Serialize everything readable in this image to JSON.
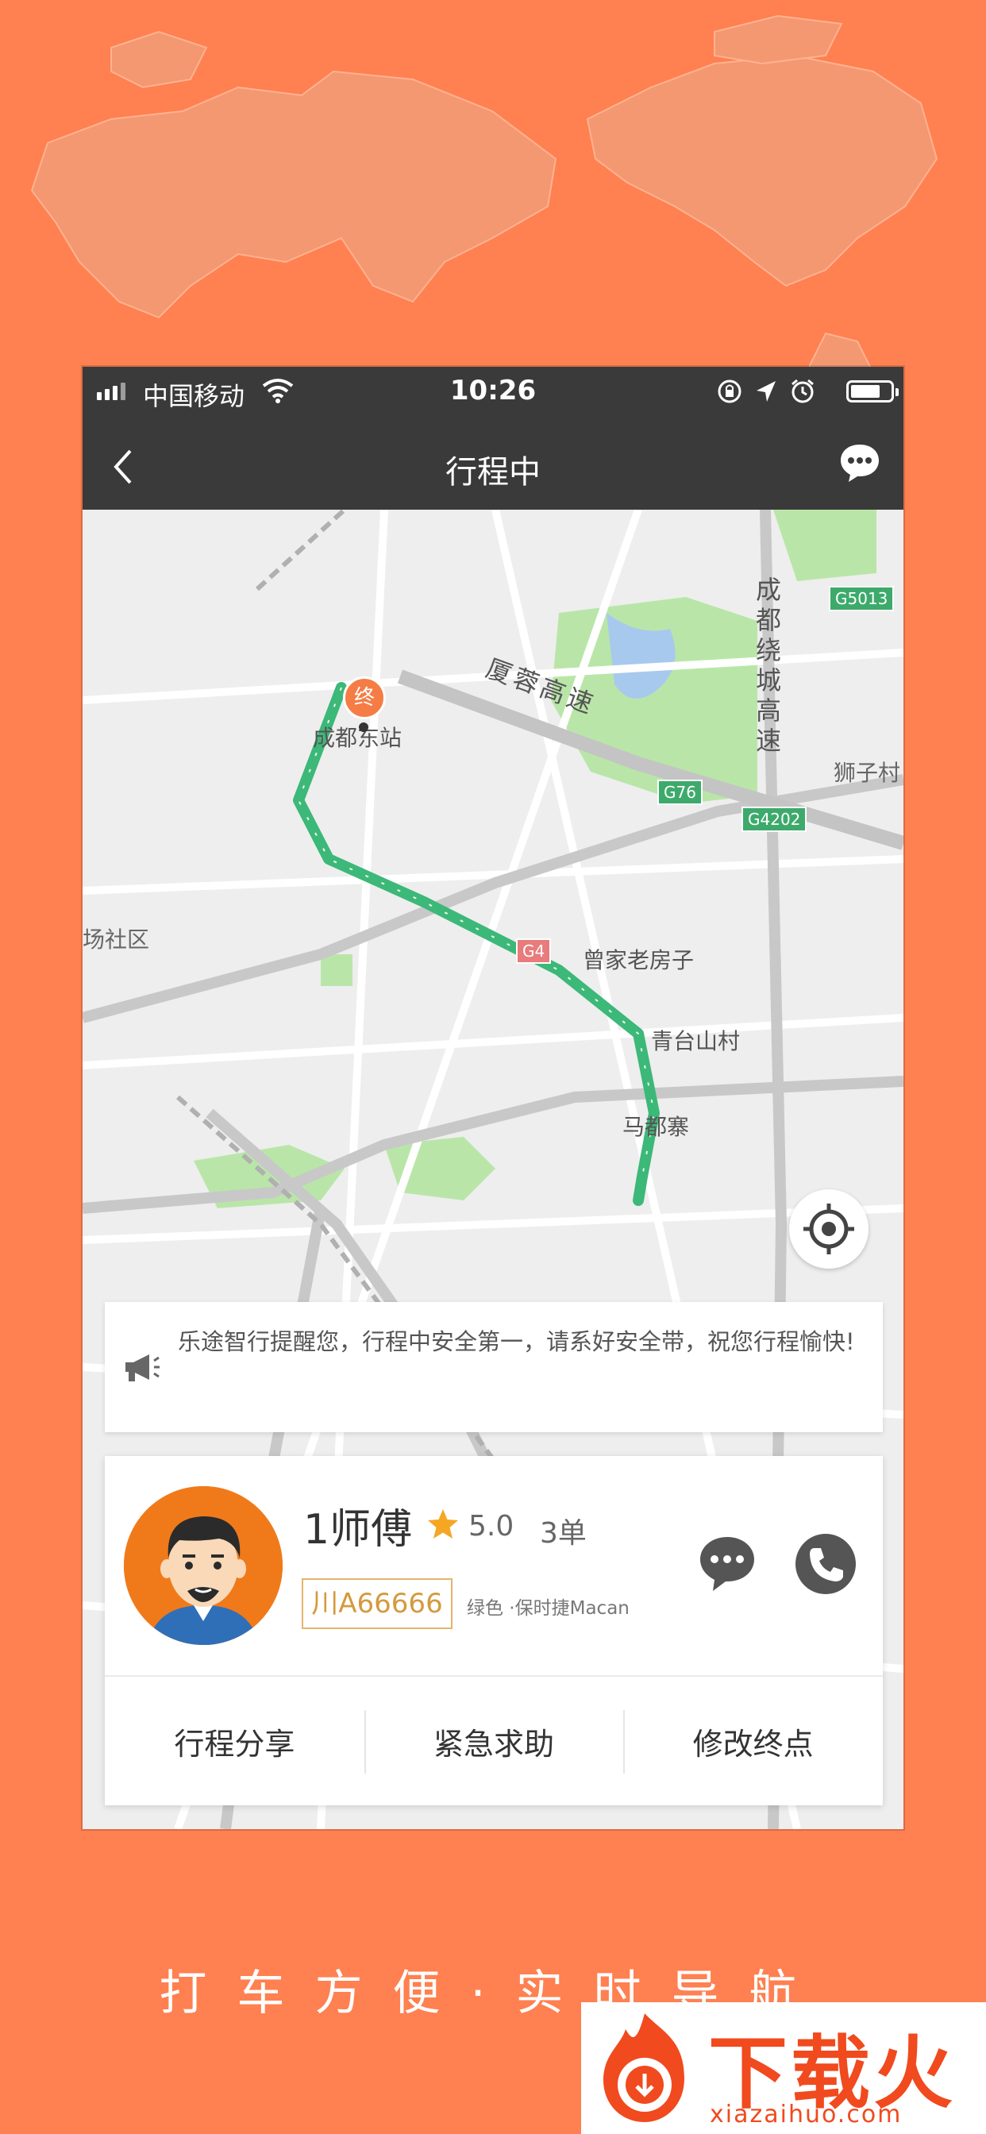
{
  "colors": {
    "background": "#FF8050",
    "bar": "#3A3A3A",
    "route": "#3CB878",
    "accent": "#F57C45",
    "plate_border": "#E6B46A"
  },
  "status_bar": {
    "carrier": "中国移动",
    "time": "10:26"
  },
  "nav": {
    "title": "行程中",
    "back_icon": "chevron-left-icon",
    "chat_icon": "chat-bubble-icon"
  },
  "map": {
    "labels": {
      "chengdu_ring": "成都绕城高速",
      "highway": "厦蓉高速",
      "station": "成都东站",
      "end_marker": "终",
      "shiziqun": "狮子村",
      "community": "场社区",
      "zengjia": "曾家老房子",
      "qingtai": "青台山村",
      "madu": "马都寨"
    },
    "shields": {
      "g5013": "G5013",
      "g76": "G76",
      "g4202": "G4202",
      "g4": "G4"
    }
  },
  "notice": {
    "text": "乐途智行提醒您，行程中安全第一，请系好安全带，祝您行程愉快!"
  },
  "driver": {
    "name": "1师傅",
    "rating": "5.0",
    "orders": "3单",
    "plate": "川A66666",
    "car_info": "绿色 ·保时捷Macan"
  },
  "actions": {
    "share": "行程分享",
    "sos": "紧急求助",
    "edit_destination": "修改终点"
  },
  "tagline": "打车方便·实时导航",
  "watermark": {
    "brand": "下载火",
    "domain": "xiazaihuo.com"
  }
}
